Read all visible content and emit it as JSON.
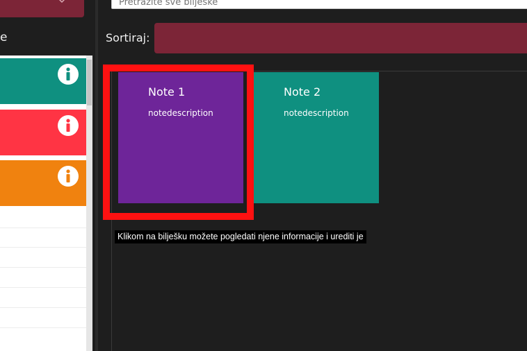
{
  "search": {
    "placeholder": "Pretražite sve bilješke"
  },
  "sidebar": {
    "partial_label": "e",
    "colored_items": [
      {
        "color": "#0f9080",
        "icon": "info-icon"
      },
      {
        "color": "#ff3444",
        "icon": "info-icon"
      },
      {
        "color": "#f0820f",
        "icon": "info-icon"
      }
    ]
  },
  "sort": {
    "label": "Sortiraj:"
  },
  "notes": [
    {
      "title": "Note 1",
      "description": "notedescription",
      "color": "#6e2599"
    },
    {
      "title": "Note 2",
      "description": "notedescription",
      "color": "#0f9080"
    }
  ],
  "tooltip": {
    "text": "Klikom na bilješku možete pogledati njene informacije i urediti je"
  },
  "colors": {
    "accent": "#7c2537",
    "highlight": "#ff1111",
    "background": "#1e1e1e"
  }
}
